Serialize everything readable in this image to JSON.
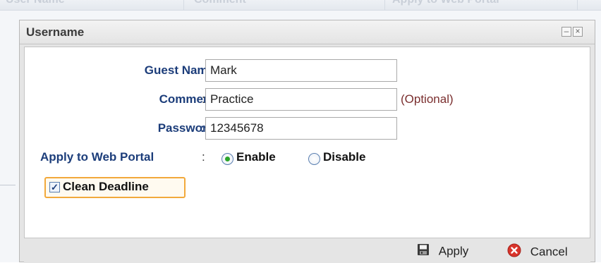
{
  "background": {
    "columns": [
      "User Name",
      "Comment",
      "Apply to Web Portal"
    ]
  },
  "dialog": {
    "title": "Username",
    "minimize_symbol": "–",
    "close_symbol": "×"
  },
  "form": {
    "guest_name": {
      "label": "Guest Name",
      "colon": ":",
      "value": "Mark"
    },
    "comment": {
      "label": "Comment",
      "colon": ":",
      "value": "Practice",
      "hint": "(Optional)"
    },
    "password": {
      "label": "Password",
      "colon": ":",
      "value": "12345678"
    },
    "web_portal": {
      "label": "Apply to Web Portal",
      "colon": ":",
      "options": [
        "Enable",
        "Disable"
      ],
      "selected": "Enable"
    },
    "clean_deadline": {
      "label": "Clean Deadline",
      "checked": true,
      "check_mark": "✓"
    }
  },
  "footer": {
    "apply_label": "Apply",
    "cancel_label": "Cancel",
    "apply_icon": "save-icon",
    "cancel_icon": "cancel-icon"
  },
  "colors": {
    "label": "#1c3d7a",
    "hint": "#7a2e2e",
    "highlight_border": "#f2a93b",
    "cancel_red": "#d9342b"
  }
}
